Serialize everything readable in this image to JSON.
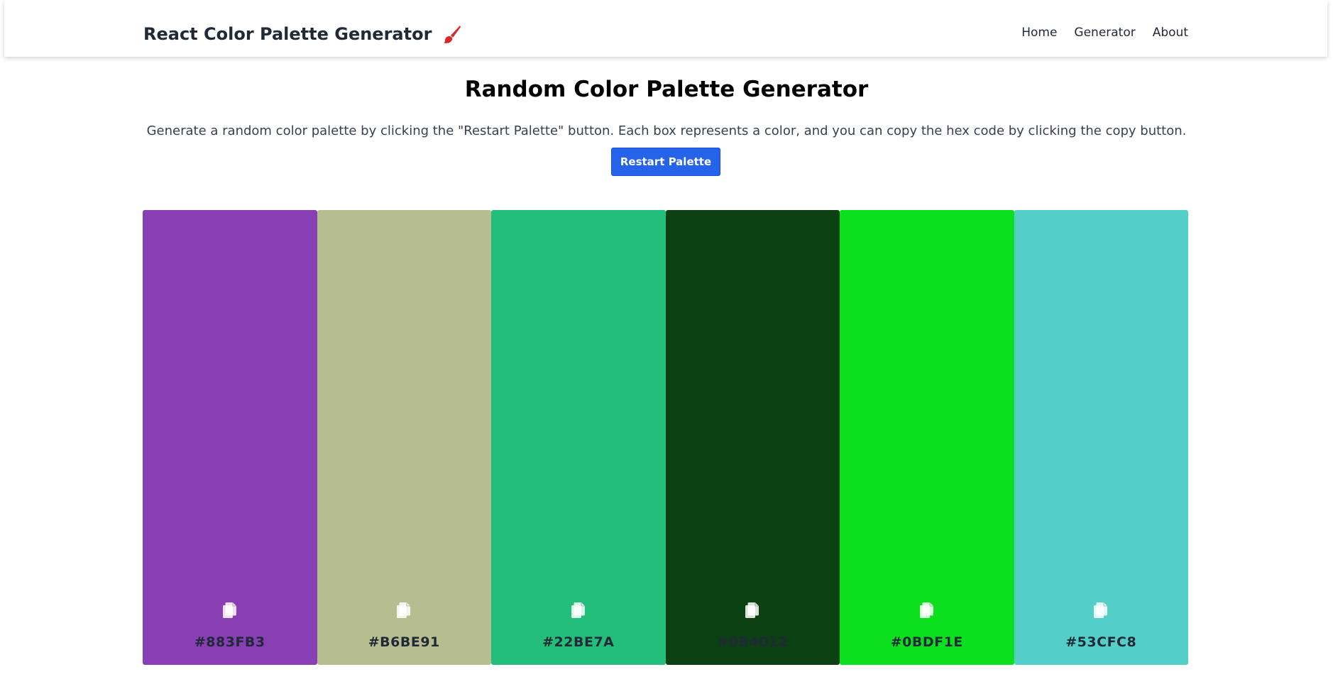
{
  "navbar": {
    "brand_title": "React Color Palette Generator",
    "brand_icon": "paintbrush-icon",
    "links": [
      {
        "label": "Home"
      },
      {
        "label": "Generator"
      },
      {
        "label": "About"
      }
    ]
  },
  "main": {
    "title": "Random Color Palette Generator",
    "description": "Generate a random color palette by clicking the \"Restart Palette\" button. Each box represents a color, and you can copy the hex code by clicking the copy button.",
    "restart_button_label": "Restart Palette"
  },
  "palette": {
    "copy_icon": "copy-icon",
    "colors": [
      {
        "hex": "#883FB3",
        "text_color": "#1f2937"
      },
      {
        "hex": "#B6BE91",
        "text_color": "#1f2937"
      },
      {
        "hex": "#22BE7A",
        "text_color": "#1f2937"
      },
      {
        "hex": "#0B4012",
        "text_color": "#1f2937"
      },
      {
        "hex": "#0BDF1E",
        "text_color": "#1f2937"
      },
      {
        "hex": "#53CFC8",
        "text_color": "#1f2937"
      }
    ]
  },
  "colors": {
    "accent": "#2563eb",
    "heading": "#000000",
    "text": "#374151"
  }
}
